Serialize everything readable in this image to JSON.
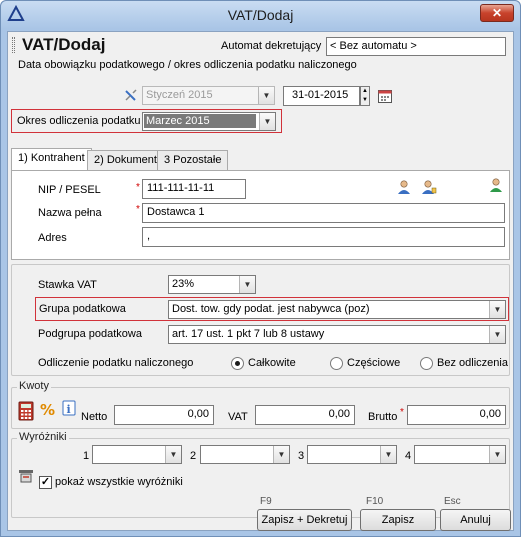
{
  "window": {
    "title": "VAT/Dodaj",
    "close_glyph": "✕"
  },
  "header": {
    "page_title": "VAT/Dodaj",
    "automat_label": "Automat dekretujący",
    "automat_value": "< Bez automatu >"
  },
  "tax_date": {
    "section_label": "Data obowiązku podatkowego / okres odliczenia podatku naliczonego",
    "period_value": "Styczeń 2015",
    "date_value": "31-01-2015",
    "okres_label": "Okres odliczenia podatku",
    "okres_value": "Marzec 2015"
  },
  "tabs": [
    {
      "label": "1) Kontrahent"
    },
    {
      "label": "2) Dokument"
    },
    {
      "label": "3 Pozostałe"
    }
  ],
  "contractor": {
    "nip_label": "NIP / PESEL",
    "nip_value": "111-111-11-11",
    "name_label": "Nazwa pełna",
    "name_value": "Dostawca 1",
    "address_label": "Adres",
    "address_value": ","
  },
  "vat": {
    "stawka_label": "Stawka VAT",
    "stawka_value": "23%",
    "grupa_label": "Grupa podatkowa",
    "grupa_value": "Dost. tow. gdy podat. jest nabywca (poz)",
    "podgrupa_label": "Podgrupa podatkowa",
    "podgrupa_value": "art. 17 ust. 1 pkt 7 lub 8 ustawy",
    "odliczenie_label": "Odliczenie podatku naliczonego",
    "radio_options": [
      "Całkowite",
      "Częściowe",
      "Bez odliczenia"
    ]
  },
  "kwoty": {
    "title": "Kwoty",
    "netto_label": "Netto",
    "netto_value": "0,00",
    "vat_label": "VAT",
    "vat_value": "0,00",
    "brutto_label": "Brutto",
    "brutto_value": "0,00"
  },
  "wyrozniki": {
    "title": "Wyróżniki",
    "nums": [
      "1",
      "2",
      "3",
      "4"
    ],
    "checkbox_label": "pokaż wszystkie wyróżniki"
  },
  "footer": {
    "keys": [
      "F9",
      "F10",
      "Esc"
    ],
    "save_decree_label": "Zapisz + Dekretuj",
    "save_label": "Zapisz",
    "cancel_label": "Anuluj"
  },
  "required_mark": "*",
  "colors": {
    "highlight_border": "#d1323a",
    "selected_fill": "#7a7a7a"
  }
}
